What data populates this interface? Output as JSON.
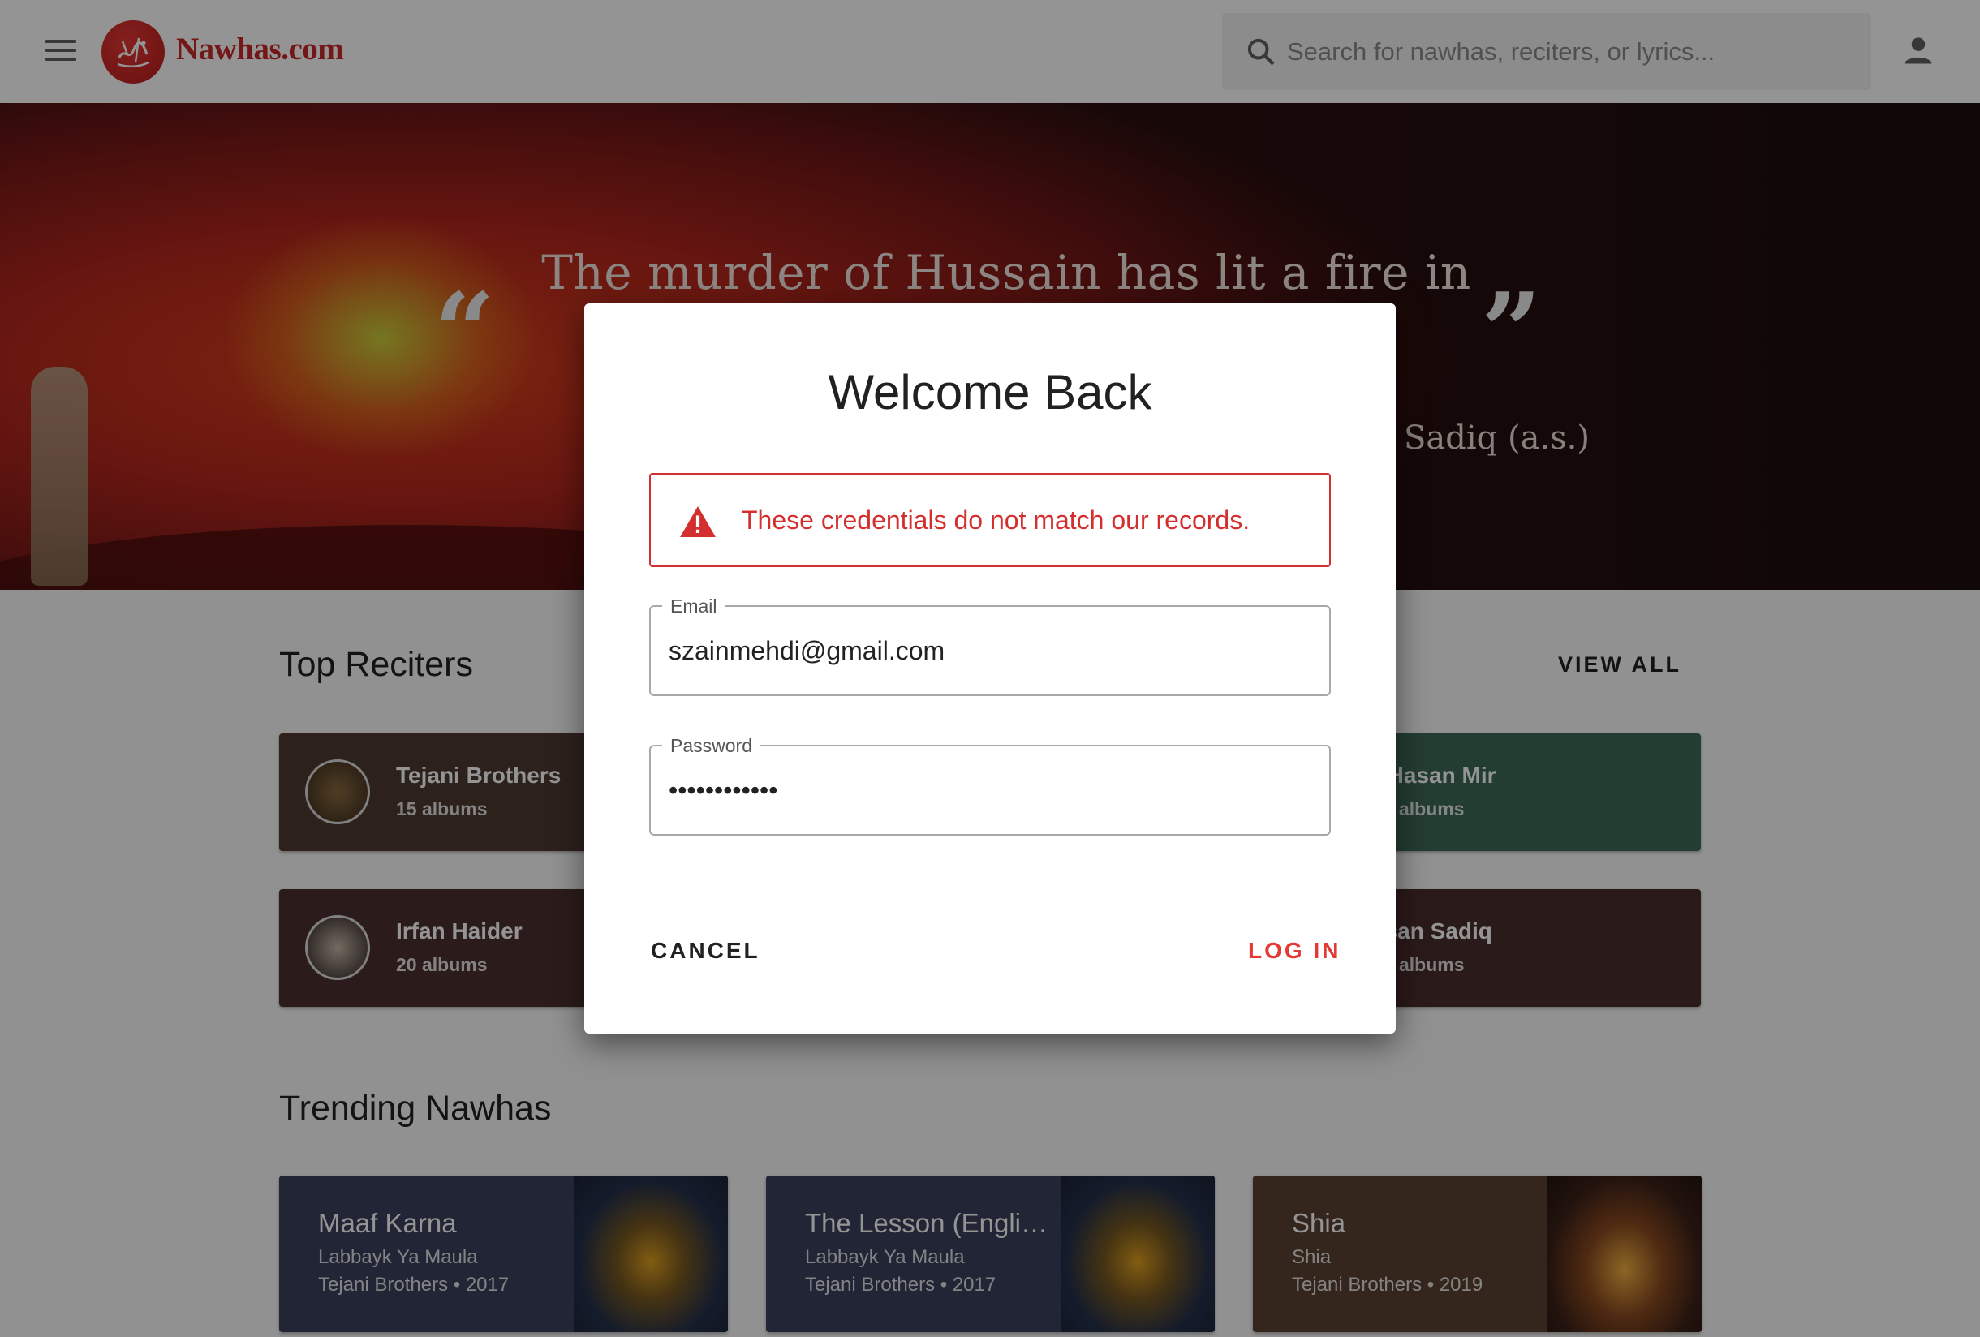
{
  "header": {
    "brand": "Nawhas.com",
    "search_placeholder": "Search for nawhas, reciters, or lyrics..."
  },
  "hero": {
    "quote_line1": "The murder of Hussain has lit a fire in the hearts",
    "quote_author_partial": "Sadiq (a.s.)",
    "open_quote": "“",
    "close_quote": "”"
  },
  "top_reciters": {
    "title": "Top Reciters",
    "view_all": "VIEW ALL",
    "cards": [
      {
        "name": "Tejani Brothers",
        "count": "15 albums",
        "color": "#4e3a31"
      },
      {
        "name": "r Hasan Mir",
        "count": "albums",
        "color": "#3f6a56"
      },
      {
        "name": "Irfan Haider",
        "count": "20 albums",
        "color": "#4b3130"
      },
      {
        "name": "ssan Sadiq",
        "count": "albums",
        "color": "#4a2e2e"
      }
    ]
  },
  "trending": {
    "title": "Trending Nawhas",
    "cards": [
      {
        "title": "Maaf Karna",
        "album": "Labbayk Ya Maula",
        "meta": "Tejani Brothers • 2017",
        "color": "#39415c"
      },
      {
        "title": "The Lesson (Engli…",
        "album": "Labbayk Ya Maula",
        "meta": "Tejani Brothers • 2017",
        "color": "#39415c"
      },
      {
        "title": "Shia",
        "album": "Shia",
        "meta": "Tejani Brothers • 2019",
        "color": "#5a4232"
      }
    ]
  },
  "dialog": {
    "title": "Welcome Back",
    "error": "These credentials do not match our records.",
    "email_label": "Email",
    "email_value": "szainmehdi@gmail.com",
    "password_label": "Password",
    "password_value": "••••••••••••",
    "cancel": "CANCEL",
    "login": "LOG IN"
  },
  "colors": {
    "brand_red": "#c62828",
    "error_red": "#d32f2f",
    "login_red": "#e53935"
  }
}
